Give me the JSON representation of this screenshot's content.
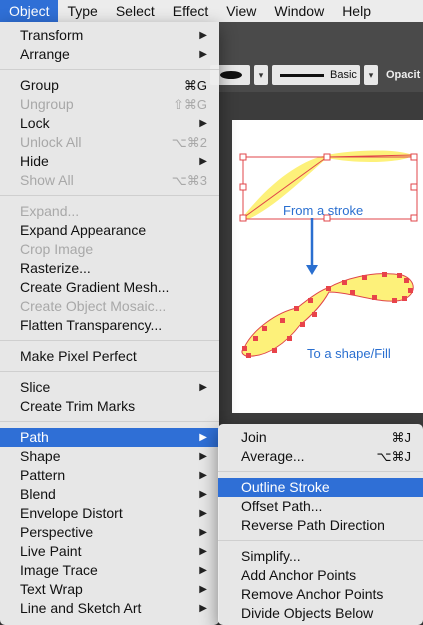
{
  "menubar": {
    "items": [
      "Object",
      "Type",
      "Select",
      "Effect",
      "View",
      "Window",
      "Help"
    ],
    "active": "Object"
  },
  "options_bar": {
    "stroke_style": "Basic",
    "opacity_label": "Opacit"
  },
  "canvas": {
    "label_stroke": "From a stroke",
    "label_shape": "To a shape/Fill"
  },
  "object_menu": {
    "transform": "Transform",
    "arrange": "Arrange",
    "group": {
      "label": "Group",
      "shortcut": "⌘G"
    },
    "ungroup": {
      "label": "Ungroup",
      "shortcut": "⇧⌘G"
    },
    "lock": "Lock",
    "unlock_all": {
      "label": "Unlock All",
      "shortcut": "⌥⌘2"
    },
    "hide": "Hide",
    "show_all": {
      "label": "Show All",
      "shortcut": "⌥⌘3"
    },
    "expand": "Expand...",
    "expand_appearance": "Expand Appearance",
    "crop_image": "Crop Image",
    "rasterize": "Rasterize...",
    "gradient_mesh": "Create Gradient Mesh...",
    "object_mosaic": "Create Object Mosaic...",
    "flatten": "Flatten Transparency...",
    "pixel_perfect": "Make Pixel Perfect",
    "slice": "Slice",
    "trim_marks": "Create Trim Marks",
    "path": "Path",
    "shape": "Shape",
    "pattern": "Pattern",
    "blend": "Blend",
    "envelope": "Envelope Distort",
    "perspective": "Perspective",
    "live_paint": "Live Paint",
    "image_trace": "Image Trace",
    "text_wrap": "Text Wrap",
    "line_sketch": "Line and Sketch Art"
  },
  "path_menu": {
    "join": {
      "label": "Join",
      "shortcut": "⌘J"
    },
    "average": {
      "label": "Average...",
      "shortcut": "⌥⌘J"
    },
    "outline_stroke": "Outline Stroke",
    "offset_path": "Offset Path...",
    "reverse": "Reverse Path Direction",
    "simplify": "Simplify...",
    "add_anchor": "Add Anchor Points",
    "remove_anchor": "Remove Anchor Points",
    "divide_below": "Divide Objects Below"
  },
  "colors": {
    "highlight": "#2f6fd6",
    "shape_fill": "#fdf17a",
    "anchor": "#e8434a",
    "label": "#2a6fd0"
  }
}
